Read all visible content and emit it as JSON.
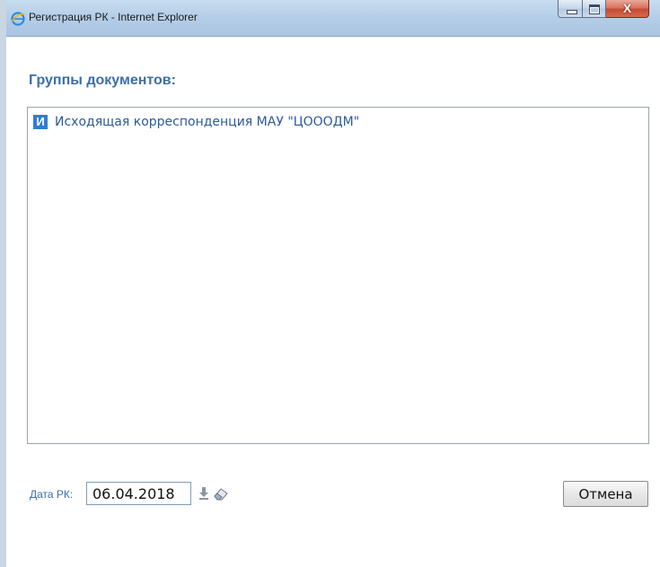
{
  "window": {
    "title": "Регистрация РК - Internet Explorer",
    "controls": {
      "close_glyph": "X"
    }
  },
  "main": {
    "heading": "Группы документов:",
    "groups": [
      {
        "icon_letter": "И",
        "label": "Исходящая корреспонденция МАУ \"ЦОООДМ\""
      }
    ]
  },
  "footer": {
    "date_label": "Дата РК:",
    "date_value": "06.04.2018",
    "cancel_label": "Отмена"
  },
  "icons": [
    "ie-logo-icon",
    "download-arrow-icon",
    "eraser-icon",
    "minimize-icon",
    "maximize-icon",
    "close-icon"
  ],
  "colors": {
    "accent": "#3b6fa8",
    "link": "#2a5a9b",
    "item_icon_bg": "#2c7fd1"
  }
}
